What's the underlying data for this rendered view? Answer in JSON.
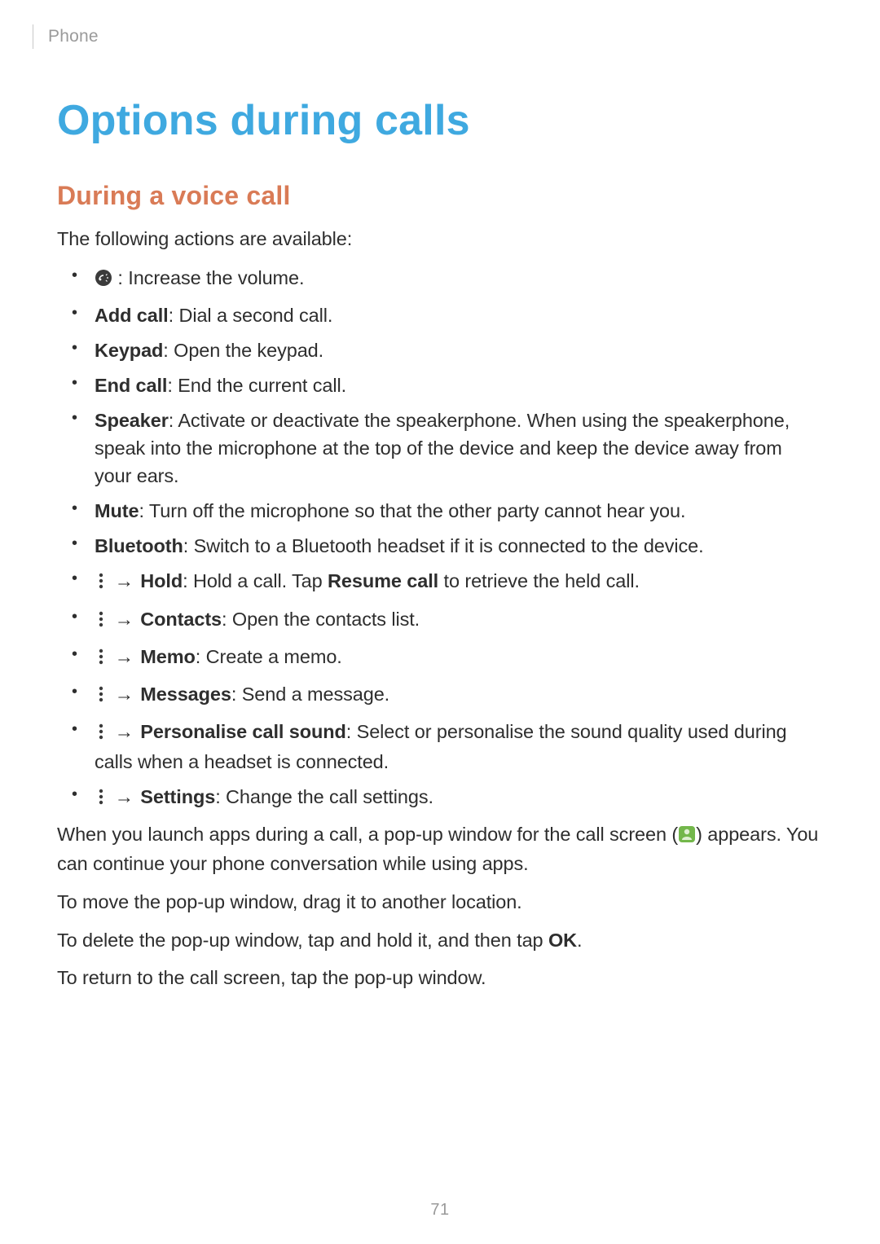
{
  "header": {
    "section_label": "Phone"
  },
  "page_title": "Options during calls",
  "section_title": "During a voice call",
  "intro": "The following actions are available:",
  "items": [
    {
      "label": null,
      "desc": " : Increase the volume.",
      "leading_icon": "volume"
    },
    {
      "label": "Add call",
      "desc": ": Dial a second call."
    },
    {
      "label": "Keypad",
      "desc": ": Open the keypad."
    },
    {
      "label": "End call",
      "desc": ": End the current call."
    },
    {
      "label": "Speaker",
      "desc": ": Activate or deactivate the speakerphone. When using the speakerphone, speak into the microphone at the top of the device and keep the device away from your ears."
    },
    {
      "label": "Mute",
      "desc": ": Turn off the microphone so that the other party cannot hear you."
    },
    {
      "label": "Bluetooth",
      "desc": ": Switch to a Bluetooth headset if it is connected to the device."
    },
    {
      "leading_icon": "more",
      "arrow": true,
      "label": "Hold",
      "desc": ": Hold a call. Tap ",
      "bold_inline": "Resume call",
      "desc_tail": " to retrieve the held call."
    },
    {
      "leading_icon": "more",
      "arrow": true,
      "label": "Contacts",
      "desc": ": Open the contacts list."
    },
    {
      "leading_icon": "more",
      "arrow": true,
      "label": "Memo",
      "desc": ": Create a memo."
    },
    {
      "leading_icon": "more",
      "arrow": true,
      "label": "Messages",
      "desc": ": Send a message."
    },
    {
      "leading_icon": "more",
      "arrow": true,
      "label": "Personalise call sound",
      "desc": ": Select or personalise the sound quality used during calls when a headset is connected."
    },
    {
      "leading_icon": "more",
      "arrow": true,
      "label": "Settings",
      "desc": ": Change the call settings."
    }
  ],
  "popup_paragraph": {
    "pre": "When you launch apps during a call, a pop-up window for the call screen (",
    "post": ") appears. You can continue your phone conversation while using apps."
  },
  "paragraph_move": "To move the pop-up window, drag it to another location.",
  "paragraph_delete_pre": "To delete the pop-up window, tap and hold it, and then tap ",
  "paragraph_delete_bold": "OK",
  "paragraph_delete_post": ".",
  "paragraph_return": "To return to the call screen, tap the pop-up window.",
  "arrow_glyph": "→",
  "page_number": "71",
  "icons": {
    "volume": "extra-volume-icon",
    "more": "more-options-icon",
    "popup": "call-popup-icon"
  },
  "colors": {
    "title_blue": "#3fa9e0",
    "subtitle_orange": "#d97b56",
    "body_text": "#2e2e2e",
    "muted": "#9a9a9a",
    "popup_green": "#73b74b"
  }
}
